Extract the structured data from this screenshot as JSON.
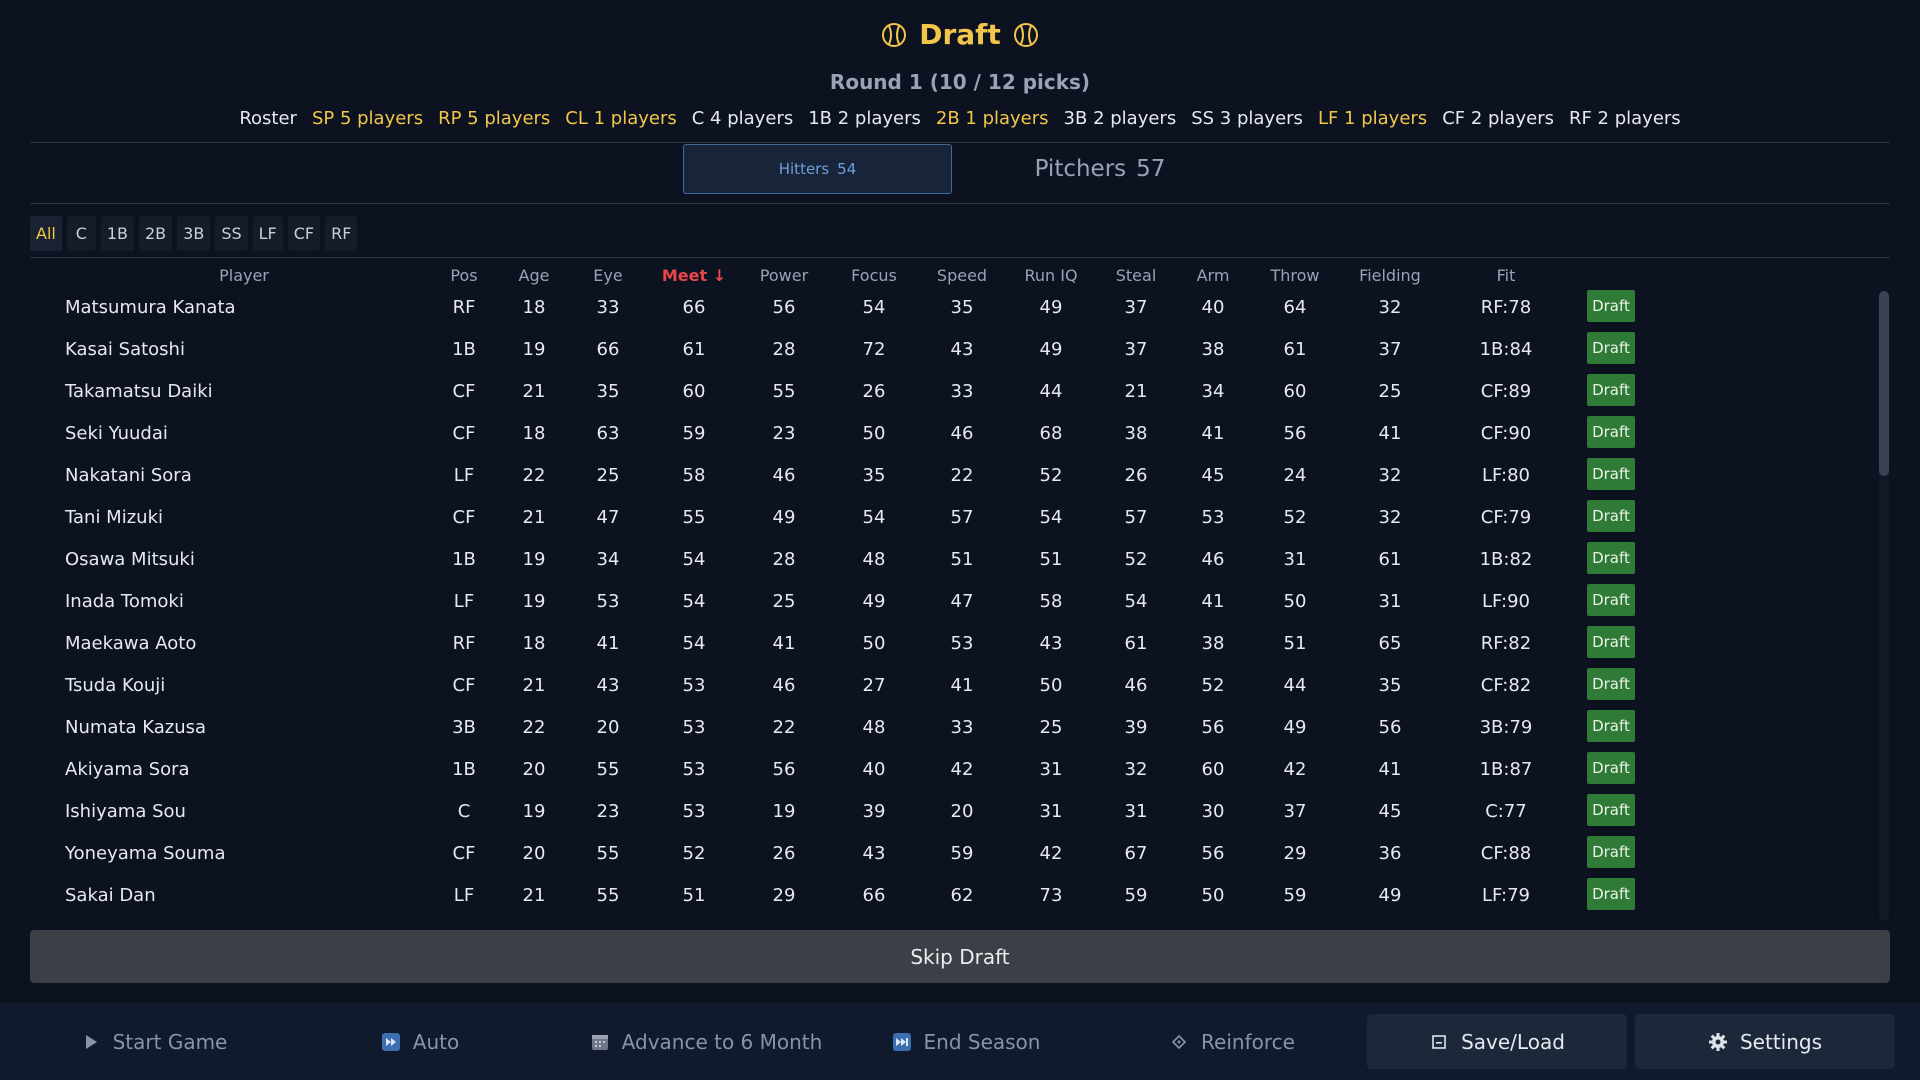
{
  "header": {
    "title": "Draft",
    "round": "Round 1  (10 / 12 picks)",
    "roster_label": "Roster",
    "roster_items": [
      {
        "label": "SP 5 players",
        "status": "warn"
      },
      {
        "label": "RP 5 players",
        "status": "warn"
      },
      {
        "label": "CL 1 players",
        "status": "warn"
      },
      {
        "label": "C 4 players",
        "status": "ok"
      },
      {
        "label": "1B 2 players",
        "status": "ok"
      },
      {
        "label": "2B 1 players",
        "status": "warn"
      },
      {
        "label": "3B 2 players",
        "status": "ok"
      },
      {
        "label": "SS 3 players",
        "status": "ok"
      },
      {
        "label": "LF 1 players",
        "status": "warn"
      },
      {
        "label": "CF 2 players",
        "status": "ok"
      },
      {
        "label": "RF 2 players",
        "status": "ok"
      }
    ]
  },
  "tabs": {
    "hitters_label": "Hitters",
    "hitters_count": "54",
    "pitchers_label": "Pitchers",
    "pitchers_count": "57"
  },
  "filters": [
    "All",
    "C",
    "1B",
    "2B",
    "3B",
    "SS",
    "LF",
    "CF",
    "RF"
  ],
  "active_filter": "All",
  "columns": [
    "Player",
    "Pos",
    "Age",
    "Eye",
    "Meet ↓",
    "Power",
    "Focus",
    "Speed",
    "Run IQ",
    "Steal",
    "Arm",
    "Throw",
    "Fielding",
    "Fit"
  ],
  "sorted_column": "Meet ↓",
  "draft_label": "Draft",
  "players": [
    [
      "Matsumura Kanata",
      "RF",
      "18",
      "33",
      "66",
      "56",
      "54",
      "35",
      "49",
      "37",
      "40",
      "64",
      "32",
      "RF:78"
    ],
    [
      "Kasai Satoshi",
      "1B",
      "19",
      "66",
      "61",
      "28",
      "72",
      "43",
      "49",
      "37",
      "38",
      "61",
      "37",
      "1B:84"
    ],
    [
      "Takamatsu Daiki",
      "CF",
      "21",
      "35",
      "60",
      "55",
      "26",
      "33",
      "44",
      "21",
      "34",
      "60",
      "25",
      "CF:89"
    ],
    [
      "Seki Yuudai",
      "CF",
      "18",
      "63",
      "59",
      "23",
      "50",
      "46",
      "68",
      "38",
      "41",
      "56",
      "41",
      "CF:90"
    ],
    [
      "Nakatani Sora",
      "LF",
      "22",
      "25",
      "58",
      "46",
      "35",
      "22",
      "52",
      "26",
      "45",
      "24",
      "32",
      "LF:80"
    ],
    [
      "Tani Mizuki",
      "CF",
      "21",
      "47",
      "55",
      "49",
      "54",
      "57",
      "54",
      "57",
      "53",
      "52",
      "32",
      "CF:79"
    ],
    [
      "Osawa Mitsuki",
      "1B",
      "19",
      "34",
      "54",
      "28",
      "48",
      "51",
      "51",
      "52",
      "46",
      "31",
      "61",
      "1B:82"
    ],
    [
      "Inada Tomoki",
      "LF",
      "19",
      "53",
      "54",
      "25",
      "49",
      "47",
      "58",
      "54",
      "41",
      "50",
      "31",
      "LF:90"
    ],
    [
      "Maekawa Aoto",
      "RF",
      "18",
      "41",
      "54",
      "41",
      "50",
      "53",
      "43",
      "61",
      "38",
      "51",
      "65",
      "RF:82"
    ],
    [
      "Tsuda Kouji",
      "CF",
      "21",
      "43",
      "53",
      "46",
      "27",
      "41",
      "50",
      "46",
      "52",
      "44",
      "35",
      "CF:82"
    ],
    [
      "Numata Kazusa",
      "3B",
      "22",
      "20",
      "53",
      "22",
      "48",
      "33",
      "25",
      "39",
      "56",
      "49",
      "56",
      "3B:79"
    ],
    [
      "Akiyama Sora",
      "1B",
      "20",
      "55",
      "53",
      "56",
      "40",
      "42",
      "31",
      "32",
      "60",
      "42",
      "41",
      "1B:87"
    ],
    [
      "Ishiyama Sou",
      "C",
      "19",
      "23",
      "53",
      "19",
      "39",
      "20",
      "31",
      "31",
      "30",
      "37",
      "45",
      "C:77"
    ],
    [
      "Yoneyama Souma",
      "CF",
      "20",
      "55",
      "52",
      "26",
      "43",
      "59",
      "42",
      "67",
      "56",
      "29",
      "36",
      "CF:88"
    ],
    [
      "Sakai Dan",
      "LF",
      "21",
      "55",
      "51",
      "29",
      "66",
      "62",
      "73",
      "59",
      "50",
      "59",
      "49",
      "LF:79"
    ]
  ],
  "skip_label": "Skip Draft",
  "footer": [
    {
      "label": "Start Game",
      "icon": "play-icon"
    },
    {
      "label": "Auto",
      "icon": "fast-forward-icon"
    },
    {
      "label": "Advance to 6 Month",
      "icon": "calendar-icon"
    },
    {
      "label": "End Season",
      "icon": "skip-forward-icon"
    },
    {
      "label": "Reinforce",
      "icon": "diamond-icon"
    },
    {
      "label": "Save/Load",
      "icon": "save-icon"
    },
    {
      "label": "Settings",
      "icon": "gear-icon"
    }
  ],
  "colors": {
    "accent": "#f3c64a",
    "sort": "#e8464a",
    "draft_button": "#2f7a36"
  }
}
